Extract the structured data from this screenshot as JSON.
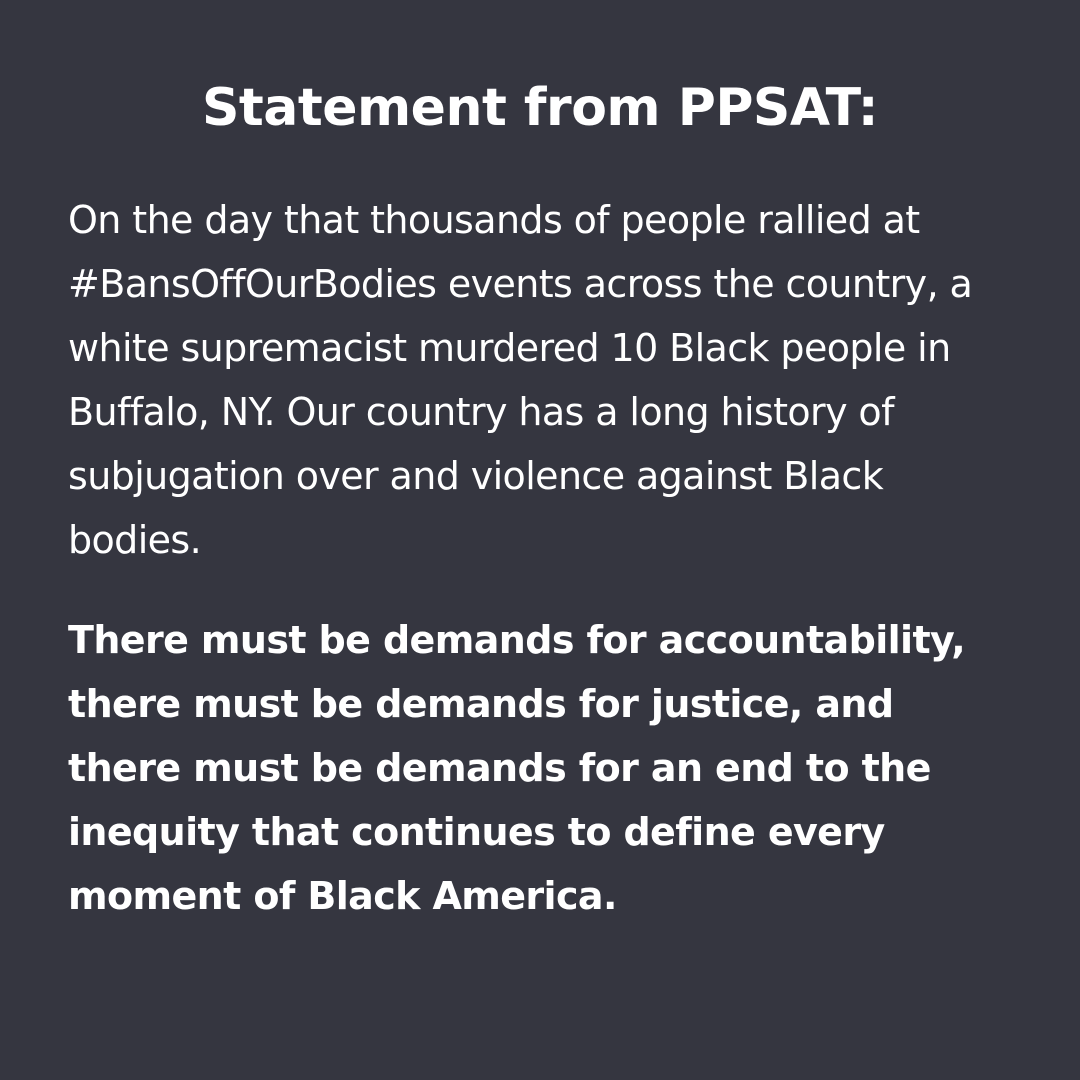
{
  "colors": {
    "background": "#353640",
    "text": "#ffffff"
  },
  "statement": {
    "title": "Statement from PPSAT:",
    "paragraph_1": "On the day that thousands of people rallied at #BansOffOurBodies events across the country, a white supremacist murdered 10 Black people in Buffalo, NY. Our country has a long history of subjugation over and violence against Black bodies.",
    "paragraph_2": "There must be demands for accountability, there must be demands for justice, and there must be demands for an end to the inequity that continues to define every moment of Black America."
  }
}
